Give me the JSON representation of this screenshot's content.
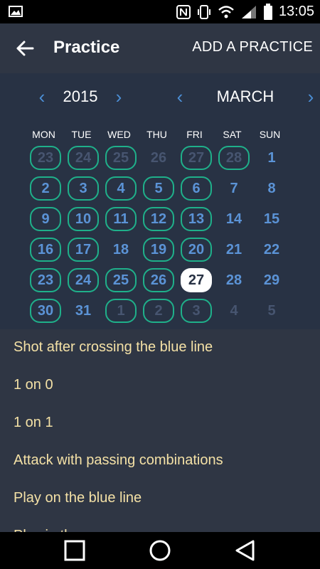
{
  "status_bar": {
    "time": "13:05",
    "icons": [
      "image-icon",
      "nfc-icon",
      "vibrate-icon",
      "wifi-icon",
      "signal-icon",
      "battery-icon"
    ]
  },
  "appbar": {
    "title": "Practice",
    "action": "ADD A PRACTICE"
  },
  "calendar": {
    "year": "2015",
    "month": "MARCH",
    "weekdays": [
      "MON",
      "TUE",
      "WED",
      "THU",
      "FRI",
      "SAT",
      "SUN"
    ],
    "weeks": [
      [
        {
          "d": "23",
          "cur": false,
          "practice": true
        },
        {
          "d": "24",
          "cur": false,
          "practice": true
        },
        {
          "d": "25",
          "cur": false,
          "practice": true
        },
        {
          "d": "26",
          "cur": false,
          "practice": false
        },
        {
          "d": "27",
          "cur": false,
          "practice": true
        },
        {
          "d": "28",
          "cur": false,
          "practice": true
        },
        {
          "d": "1",
          "cur": true,
          "practice": false
        }
      ],
      [
        {
          "d": "2",
          "cur": true,
          "practice": true
        },
        {
          "d": "3",
          "cur": true,
          "practice": true
        },
        {
          "d": "4",
          "cur": true,
          "practice": true
        },
        {
          "d": "5",
          "cur": true,
          "practice": true
        },
        {
          "d": "6",
          "cur": true,
          "practice": true
        },
        {
          "d": "7",
          "cur": true,
          "practice": false
        },
        {
          "d": "8",
          "cur": true,
          "practice": false
        }
      ],
      [
        {
          "d": "9",
          "cur": true,
          "practice": true
        },
        {
          "d": "10",
          "cur": true,
          "practice": true
        },
        {
          "d": "11",
          "cur": true,
          "practice": true
        },
        {
          "d": "12",
          "cur": true,
          "practice": true
        },
        {
          "d": "13",
          "cur": true,
          "practice": true
        },
        {
          "d": "14",
          "cur": true,
          "practice": false
        },
        {
          "d": "15",
          "cur": true,
          "practice": false
        }
      ],
      [
        {
          "d": "16",
          "cur": true,
          "practice": true
        },
        {
          "d": "17",
          "cur": true,
          "practice": true
        },
        {
          "d": "18",
          "cur": true,
          "practice": false
        },
        {
          "d": "19",
          "cur": true,
          "practice": true
        },
        {
          "d": "20",
          "cur": true,
          "practice": true
        },
        {
          "d": "21",
          "cur": true,
          "practice": false
        },
        {
          "d": "22",
          "cur": true,
          "practice": false
        }
      ],
      [
        {
          "d": "23",
          "cur": true,
          "practice": true
        },
        {
          "d": "24",
          "cur": true,
          "practice": true
        },
        {
          "d": "25",
          "cur": true,
          "practice": true
        },
        {
          "d": "26",
          "cur": true,
          "practice": true
        },
        {
          "d": "27",
          "cur": true,
          "practice": false,
          "today": true
        },
        {
          "d": "28",
          "cur": true,
          "practice": false
        },
        {
          "d": "29",
          "cur": true,
          "practice": false
        }
      ],
      [
        {
          "d": "30",
          "cur": true,
          "practice": true
        },
        {
          "d": "31",
          "cur": true,
          "practice": false
        },
        {
          "d": "1",
          "cur": false,
          "practice": true
        },
        {
          "d": "2",
          "cur": false,
          "practice": true
        },
        {
          "d": "3",
          "cur": false,
          "practice": true
        },
        {
          "d": "4",
          "cur": false,
          "practice": false
        },
        {
          "d": "5",
          "cur": false,
          "practice": false
        }
      ]
    ]
  },
  "practices": [
    "Shot after crossing the blue line",
    "1 on 0",
    "1 on 1",
    "Attack with passing combinations",
    "Play on the blue line",
    "Play in the"
  ],
  "colors": {
    "background": "#2f3644",
    "calendar_bg": "#283244",
    "practice_ring": "#1fb08a",
    "current_day": "#5b93d6",
    "other_month_day": "#475570",
    "list_text": "#f4e1a6",
    "nav_arrow": "#4c8fd6"
  },
  "navbar": {
    "buttons": [
      "recents-button",
      "home-button",
      "back-button"
    ]
  }
}
